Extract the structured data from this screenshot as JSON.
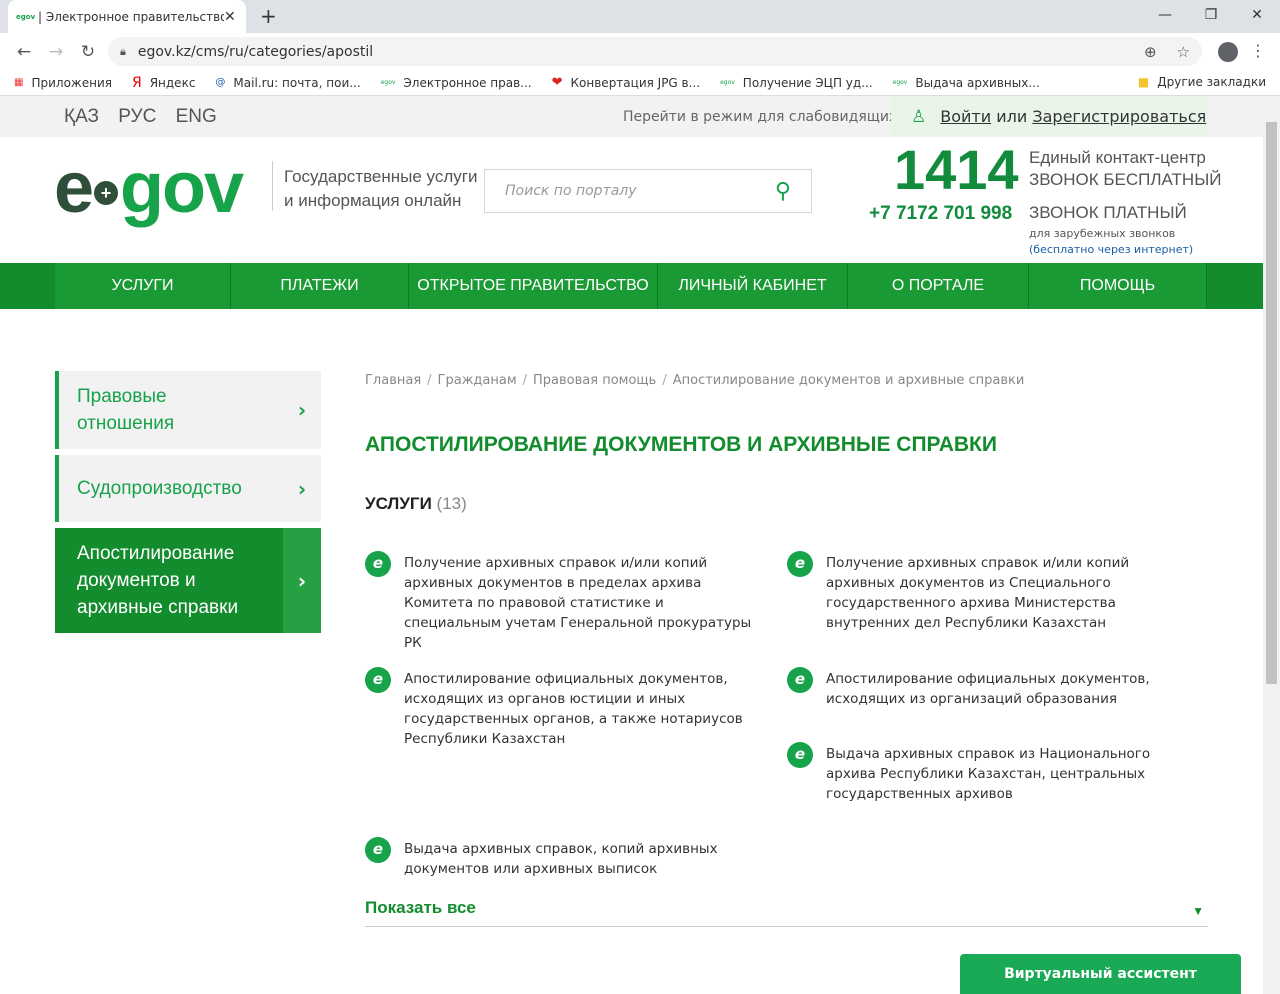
{
  "browser": {
    "tab_title": "| Электронное правительство Р",
    "tab_favicon": "egov",
    "url": "egov.kz/cms/ru/categories/apostil",
    "bookmarks": [
      {
        "label": "Приложения",
        "icon": "apps-grid-icon"
      },
      {
        "label": "Яндекс",
        "icon": "yandex-icon"
      },
      {
        "label": "Mail.ru: почта, пои...",
        "icon": "mailru-icon"
      },
      {
        "label": "Электронное прав...",
        "icon": "egov-icon"
      },
      {
        "label": "Конвертация JPG в...",
        "icon": "heart-icon"
      },
      {
        "label": "Получение ЭЦП уд...",
        "icon": "egov-icon"
      },
      {
        "label": "Выдача архивных...",
        "icon": "egov-icon"
      }
    ],
    "other_bookmarks": "Другие закладки"
  },
  "topbar": {
    "langs": [
      "ҚАЗ",
      "РУС",
      "ENG"
    ],
    "low_vision": "Перейти в режим для слабовидящих",
    "login": "Войти",
    "or": " или ",
    "register": "Зарегистрироваться"
  },
  "header": {
    "logo_e": "e",
    "logo_gov": "gov",
    "tagline_1": "Государственные услуги",
    "tagline_2": "и информация онлайн",
    "search_placeholder": "Поиск по порталу",
    "phone_free": "1414",
    "contact_center": "Единый контакт-центр",
    "call_free": "ЗВОНОК БЕСПЛАТНЫЙ",
    "phone_paid": "+7 7172 701 998",
    "call_paid": "ЗВОНОК ПЛАТНЫЙ",
    "foreign_calls": "для зарубежных звонков",
    "free_via_internet": "(бесплатно через интернет)"
  },
  "nav": [
    "УСЛУГИ",
    "ПЛАТЕЖИ",
    "ОТКРЫТОЕ ПРАВИТЕЛЬСТВО",
    "ЛИЧНЫЙ КАБИНЕТ",
    "О ПОРТАЛЕ",
    "ПОМОЩЬ"
  ],
  "sidebar": [
    {
      "label": "Правовые отношения"
    },
    {
      "label": "Судопроизводство"
    },
    {
      "label": "Апостилирование документов и архивные справки"
    }
  ],
  "breadcrumbs": [
    "Главная",
    "Гражданам",
    "Правовая помощь",
    "Апостилирование документов и архивные справки"
  ],
  "page_title": "АПОСТИЛИРОВАНИЕ ДОКУМЕНТОВ И АРХИВНЫЕ СПРАВКИ",
  "services_label": "УСЛУГИ",
  "services_count": "(13)",
  "services": [
    "Получение архивных справок и/или копий архивных документов в пределах архива Комитета по правовой статистике и специальным учетам Генеральной прокуратуры РК",
    "Получение архивных справок и/или копий архивных документов из Специального государственного архива Министерства внутренних дел Республики Казахстан",
    "Апостилирование официальных документов, исходящих из органов юстиции и иных государственных органов, а также нотариусов Республики Казахстан",
    "Апостилирование официальных документов, исходящих из организаций образования",
    "Выдача архивных справок из Национального архива Республики Казахстан, центральных государственных архивов",
    "Выдача архивных справок, копий архивных документов или архивных выписок"
  ],
  "service_icon_letter": "e",
  "show_all": "Показать все",
  "assistant": "Виртуальный ассистент",
  "colors": {
    "brand_green": "#128c2c",
    "accent_green": "#17a34a"
  }
}
